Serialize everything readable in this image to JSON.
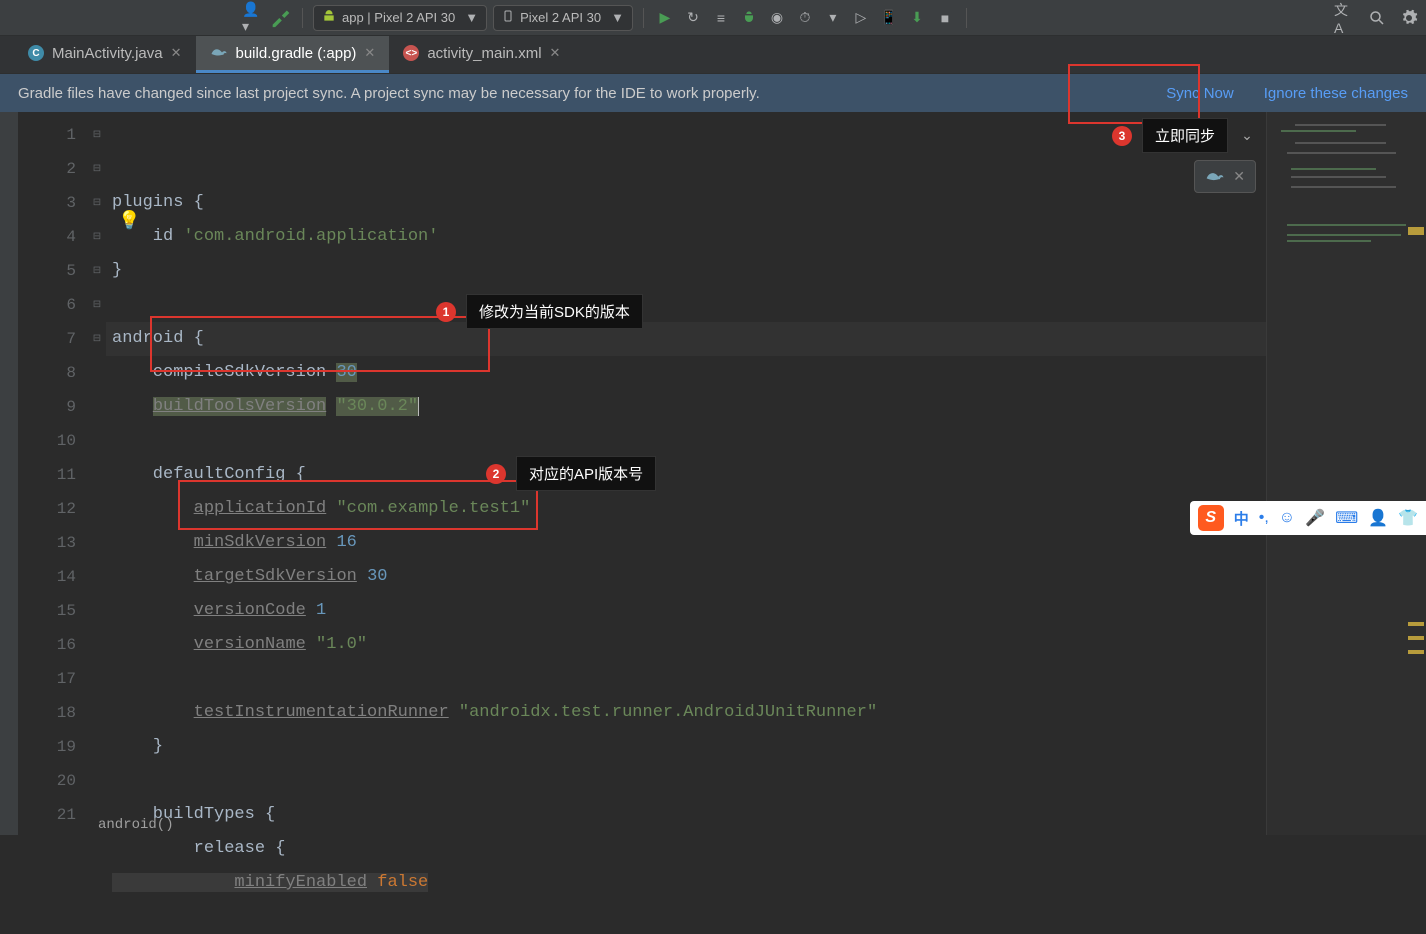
{
  "toolbar": {
    "run_config": "app | Pixel 2 API 30",
    "device": "Pixel 2 API 30"
  },
  "tabs": [
    {
      "label": "MainActivity.java",
      "icon": "c",
      "active": false
    },
    {
      "label": "build.gradle (:app)",
      "icon": "gradle",
      "active": true
    },
    {
      "label": "activity_main.xml",
      "icon": "xml",
      "active": false
    }
  ],
  "notification": {
    "message": "Gradle files have changed since last project sync. A project sync may be necessary for the IDE to work properly.",
    "sync": "Sync Now",
    "ignore": "Ignore these changes"
  },
  "code": {
    "lines": [
      "1",
      "2",
      "3",
      "4",
      "5",
      "6",
      "7",
      "8",
      "9",
      "10",
      "11",
      "12",
      "13",
      "14",
      "15",
      "16",
      "17",
      "18",
      "19",
      "20",
      "21"
    ],
    "l1a": "plugins ",
    "l1b": "{",
    "l2a": "    id ",
    "l2b": "'com.android.application'",
    "l3a": "}",
    "l5a": "android ",
    "l5b": "{",
    "l6a": "    compileSdkVersion ",
    "l6b": "30",
    "l7a": "    ",
    "l7b": "buildToolsVersion",
    "l7c": " ",
    "l7d": "\"30.0.2\"",
    "l9a": "    defaultConfig ",
    "l9b": "{",
    "l10a": "        ",
    "l10b": "applicationId",
    "l10c": " ",
    "l10d": "\"com.example.test1\"",
    "l11a": "        ",
    "l11b": "minSdkVersion",
    "l11c": " ",
    "l11d": "16",
    "l12a": "        ",
    "l12b": "targetSdkVersion",
    "l12c": " ",
    "l12d": "30",
    "l13a": "        ",
    "l13b": "versionCode",
    "l13c": " ",
    "l13d": "1",
    "l14a": "        ",
    "l14b": "versionName",
    "l14c": " ",
    "l14d": "\"1.0\"",
    "l16a": "        ",
    "l16b": "testInstrumentationRunner",
    "l16c": " ",
    "l16d": "\"androidx.test.runner.AndroidJUnitRunner\"",
    "l17a": "    ",
    "l17b": "}",
    "l19a": "    buildTypes ",
    "l19b": "{",
    "l20a": "        release ",
    "l20b": "{",
    "l21a": "            ",
    "l21b": "minifyEnabled",
    "l21c": " ",
    "l21d": "false",
    "breadcrumb": "android()"
  },
  "annotations": {
    "a1": "修改为当前SDK的版本",
    "a2": "对应的API版本号",
    "a3": "立即同步"
  },
  "ime": {
    "zhong": "中"
  }
}
